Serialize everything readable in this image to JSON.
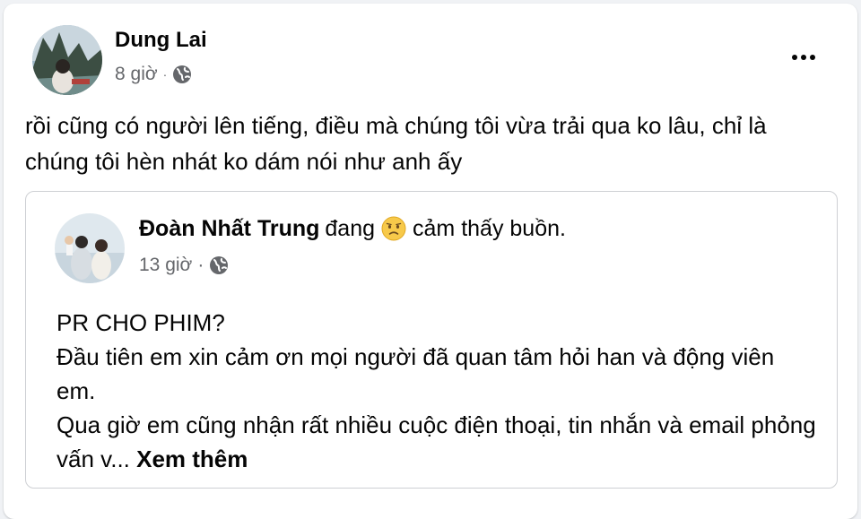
{
  "post": {
    "author": "Dung Lai",
    "time": "8 giờ",
    "separator": "·",
    "privacy_icon": "globe-icon",
    "text": "rồi cũng có người lên tiếng, điều mà chúng tôi vừa trải qua ko lâu, chỉ là chúng tôi hèn nhát ko dám nói như anh ấy",
    "more_icon": "more-options-icon"
  },
  "shared_post": {
    "author": "Đoàn Nhất Trung",
    "feeling_prefix": "đang",
    "feeling_icon": "sad-face-emoji-icon",
    "feeling_text": "cảm thấy buồn.",
    "time": "13 giờ",
    "separator": "·",
    "privacy_icon": "globe-icon",
    "lines": [
      "PR CHO PHIM?",
      "Đầu tiên em xin cảm ơn mọi người đã quan tâm hỏi han và động viên em.",
      "Qua giờ em cũng nhận rất nhiều cuộc điện thoại, tin nhắn và email phỏng vấn v..."
    ],
    "see_more": "Xem thêm"
  }
}
